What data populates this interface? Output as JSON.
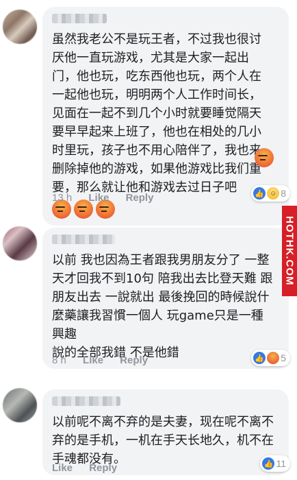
{
  "comments": [
    {
      "text": "虽然我老公不是玩王者，不过我也很讨厌他一直玩游戏，尤其是大家一起出门，他也玩，吃东西他也玩，两个人在一起他也玩，明明两个人工作时间长，见面在一起不到几个小时就要睡觉隔天要早早起来上班了，他也在相处的几小时里玩，孩子也不用心陪伴了，我也来删除掉他的游戏，如果他游戏比我们重要，那么就让他和游戏去过日子吧",
      "time": "13 h",
      "like": "Like",
      "reply": "Reply",
      "reaction_icons": [
        "like-icon",
        "haha-icon"
      ],
      "reaction_count": "8"
    },
    {
      "text": "以前 我也因為王者跟我男朋友分了 一整天才回我不到10句 陪我出去比登天難 跟朋友出去 一說就出 最後挽回的時候說什麼藥讓我習慣一個人 玩game只是一種興趣\n說的全部我錯 不是他錯",
      "time": "8 h",
      "like": "Like",
      "reply": "Reply",
      "reaction_icons": [
        "like-icon",
        "angry-icon"
      ],
      "reaction_count": "5"
    },
    {
      "text": "以前呢不离不弃的是夫妻，现在呢不离不弃的是手机，一机在手天长地久，机不在手魂都没有。",
      "time": "",
      "like": "Like",
      "reply": "Reply",
      "reaction_icons": [
        "like-icon"
      ],
      "reaction_count": "11"
    }
  ],
  "watermark": "HOTHK.COM"
}
